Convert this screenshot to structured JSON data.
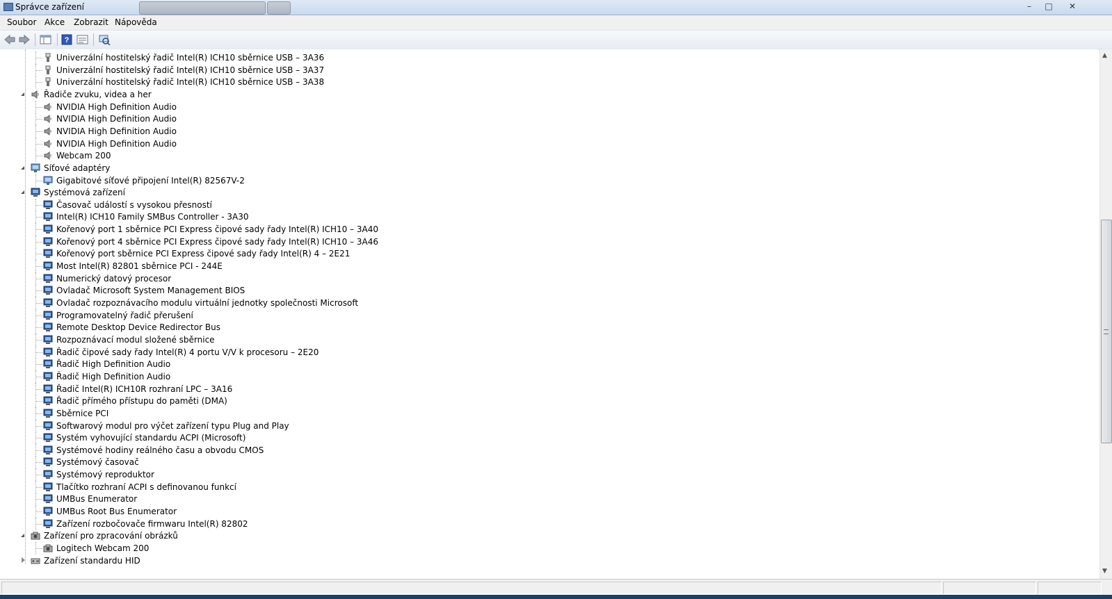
{
  "window": {
    "title": "Správce zařízení",
    "controls": [
      "–",
      "□",
      "✕"
    ]
  },
  "menu": [
    "Soubor",
    "Akce",
    "Zobrazit",
    "Nápověda"
  ],
  "toolbar": {
    "buttons": [
      {
        "name": "back-icon",
        "glyph": "⇦"
      },
      {
        "name": "forward-icon",
        "glyph": "⇨"
      },
      {
        "name": "show-hide-console-tree-icon",
        "glyph": "▥"
      },
      {
        "name": "help-icon",
        "glyph": "?"
      },
      {
        "name": "properties-icon",
        "glyph": "▤"
      },
      {
        "name": "scan-hardware-icon",
        "glyph": "⟲"
      }
    ]
  },
  "tree": [
    {
      "level": 1,
      "icon": "usb",
      "label": "Univerzální hostitelský řadič Intel(R) ICH10 sběrnice USB – 3A36"
    },
    {
      "level": 1,
      "icon": "usb",
      "label": "Univerzální hostitelský řadič Intel(R) ICH10 sběrnice USB – 3A37"
    },
    {
      "level": 1,
      "icon": "usb",
      "label": "Univerzální hostitelský řadič Intel(R) ICH10 sběrnice USB – 3A38"
    },
    {
      "level": 0,
      "icon": "sound",
      "expanded": true,
      "label": "Řadiče zvuku, videa a her"
    },
    {
      "level": 1,
      "icon": "sound",
      "label": "NVIDIA High Definition Audio"
    },
    {
      "level": 1,
      "icon": "sound",
      "label": "NVIDIA High Definition Audio"
    },
    {
      "level": 1,
      "icon": "sound",
      "label": "NVIDIA High Definition Audio"
    },
    {
      "level": 1,
      "icon": "sound",
      "label": "NVIDIA High Definition Audio"
    },
    {
      "level": 1,
      "icon": "sound",
      "label": "Webcam 200"
    },
    {
      "level": 0,
      "icon": "network",
      "expanded": true,
      "label": "Síťové adaptéry"
    },
    {
      "level": 1,
      "icon": "network",
      "label": "Gigabitové síťové připojení Intel(R) 82567V-2"
    },
    {
      "level": 0,
      "icon": "system",
      "expanded": true,
      "label": "Systémová zařízení"
    },
    {
      "level": 1,
      "icon": "system",
      "label": "Časovač událostí s vysokou přesností"
    },
    {
      "level": 1,
      "icon": "system",
      "label": "Intel(R) ICH10 Family SMBus Controller - 3A30"
    },
    {
      "level": 1,
      "icon": "system",
      "label": "Kořenový port 1 sběrnice PCI Express čipové sady řady Intel(R) ICH10 – 3A40"
    },
    {
      "level": 1,
      "icon": "system",
      "label": "Kořenový port 4 sběrnice PCI Express čipové sady řady Intel(R) ICH10 – 3A46"
    },
    {
      "level": 1,
      "icon": "system",
      "label": "Kořenový port sběrnice PCI Express čipové sady řady Intel(R) 4 – 2E21"
    },
    {
      "level": 1,
      "icon": "system",
      "label": "Most Intel(R) 82801 sběrnice PCI - 244E"
    },
    {
      "level": 1,
      "icon": "system",
      "label": "Numerický datový procesor"
    },
    {
      "level": 1,
      "icon": "system",
      "label": "Ovladač Microsoft System Management BIOS"
    },
    {
      "level": 1,
      "icon": "system",
      "label": "Ovladač rozpoznávacího modulu virtuální jednotky společnosti Microsoft"
    },
    {
      "level": 1,
      "icon": "system",
      "label": "Programovatelný řadič přerušení"
    },
    {
      "level": 1,
      "icon": "system",
      "label": "Remote Desktop Device Redirector Bus"
    },
    {
      "level": 1,
      "icon": "system",
      "label": "Rozpoznávací modul složené sběrnice"
    },
    {
      "level": 1,
      "icon": "system",
      "label": "Řadič čipové sady řady Intel(R) 4 portu V/V k procesoru – 2E20"
    },
    {
      "level": 1,
      "icon": "system",
      "label": "Řadič High Definition Audio"
    },
    {
      "level": 1,
      "icon": "system",
      "label": "Řadič High Definition Audio"
    },
    {
      "level": 1,
      "icon": "system",
      "label": "Řadič Intel(R) ICH10R rozhraní LPC – 3A16"
    },
    {
      "level": 1,
      "icon": "system",
      "label": "Řadič přímého přístupu do paměti (DMA)"
    },
    {
      "level": 1,
      "icon": "system",
      "label": "Sběrnice PCI"
    },
    {
      "level": 1,
      "icon": "system",
      "label": "Softwarový modul pro výčet zařízení typu Plug and Play"
    },
    {
      "level": 1,
      "icon": "system",
      "label": "Systém vyhovující standardu ACPI (Microsoft)"
    },
    {
      "level": 1,
      "icon": "system",
      "label": "Systémové hodiny reálného času a obvodu CMOS"
    },
    {
      "level": 1,
      "icon": "system",
      "label": "Systémový časovač"
    },
    {
      "level": 1,
      "icon": "system",
      "label": "Systémový reproduktor"
    },
    {
      "level": 1,
      "icon": "system",
      "label": "Tlačítko rozhraní ACPI s definovanou funkcí"
    },
    {
      "level": 1,
      "icon": "system",
      "label": "UMBus Enumerator"
    },
    {
      "level": 1,
      "icon": "system",
      "label": "UMBus Root Bus Enumerator"
    },
    {
      "level": 1,
      "icon": "system",
      "label": "Zařízení rozbočovače firmwaru Intel(R) 82802"
    },
    {
      "level": 0,
      "icon": "imaging",
      "expanded": true,
      "label": "Zařízení pro zpracování obrázků"
    },
    {
      "level": 1,
      "icon": "imaging",
      "label": "Logitech Webcam 200"
    },
    {
      "level": 0,
      "icon": "hid",
      "expanded": false,
      "label": "Zařízení standardu HID"
    }
  ],
  "scrollbar": {
    "position_fraction": 0.56,
    "visible_fraction": 0.44
  },
  "colors": {
    "accent": "#2b4f86",
    "icon_usb": "#707070",
    "icon_system": "#2a5a9a",
    "icon_network": "#3a7a3a"
  }
}
